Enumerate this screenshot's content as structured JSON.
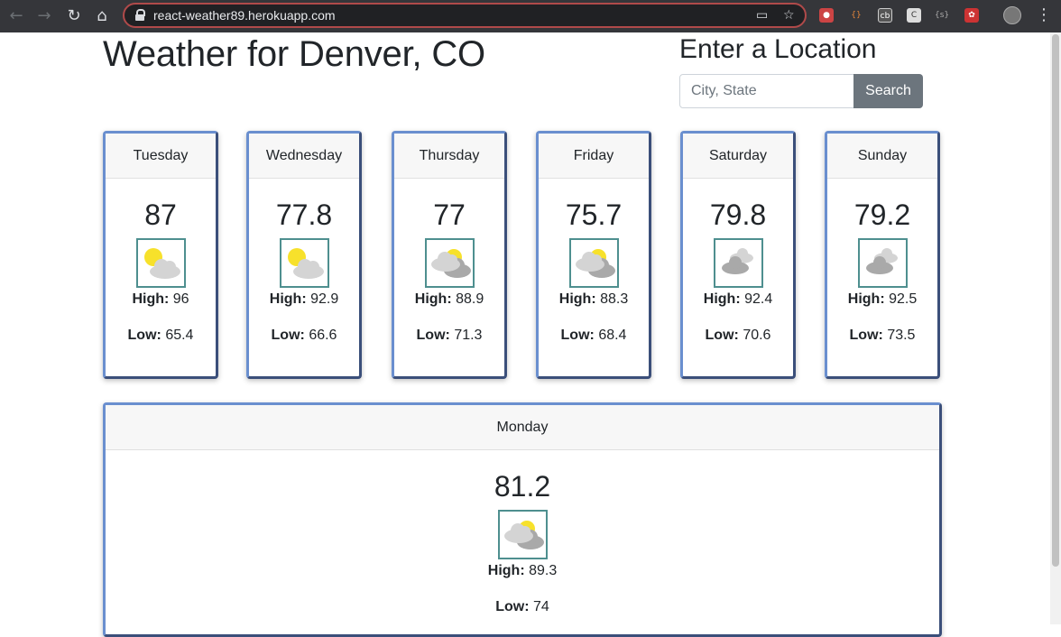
{
  "browser": {
    "url": "react-weather89.herokuapp.com"
  },
  "header": {
    "title": "Weather for Denver, CO",
    "location_title": "Enter a Location",
    "search_placeholder": "City, State",
    "search_button": "Search"
  },
  "labels": {
    "high": "High:",
    "low": "Low:"
  },
  "days": [
    {
      "day": "Tuesday",
      "temp": "87",
      "high": "96",
      "low": "65.4",
      "icon": "partly-sunny-icon"
    },
    {
      "day": "Wednesday",
      "temp": "77.8",
      "high": "92.9",
      "low": "66.6",
      "icon": "partly-sunny-icon"
    },
    {
      "day": "Thursday",
      "temp": "77",
      "high": "88.9",
      "low": "71.3",
      "icon": "mostly-cloudy-icon"
    },
    {
      "day": "Friday",
      "temp": "75.7",
      "high": "88.3",
      "low": "68.4",
      "icon": "mostly-cloudy-icon"
    },
    {
      "day": "Saturday",
      "temp": "79.8",
      "high": "92.4",
      "low": "70.6",
      "icon": "cloudy-icon"
    },
    {
      "day": "Sunday",
      "temp": "79.2",
      "high": "92.5",
      "low": "73.5",
      "icon": "cloudy-icon"
    }
  ],
  "today": {
    "day": "Monday",
    "temp": "81.2",
    "high": "89.3",
    "low": "74",
    "icon": "mostly-cloudy-icon"
  },
  "colors": {
    "sun": "#f7e12b",
    "cloud_light": "#d4d4d4",
    "cloud_dark": "#a9a9a9",
    "button": "#6c757d",
    "card_border": "#6a8fcf"
  }
}
